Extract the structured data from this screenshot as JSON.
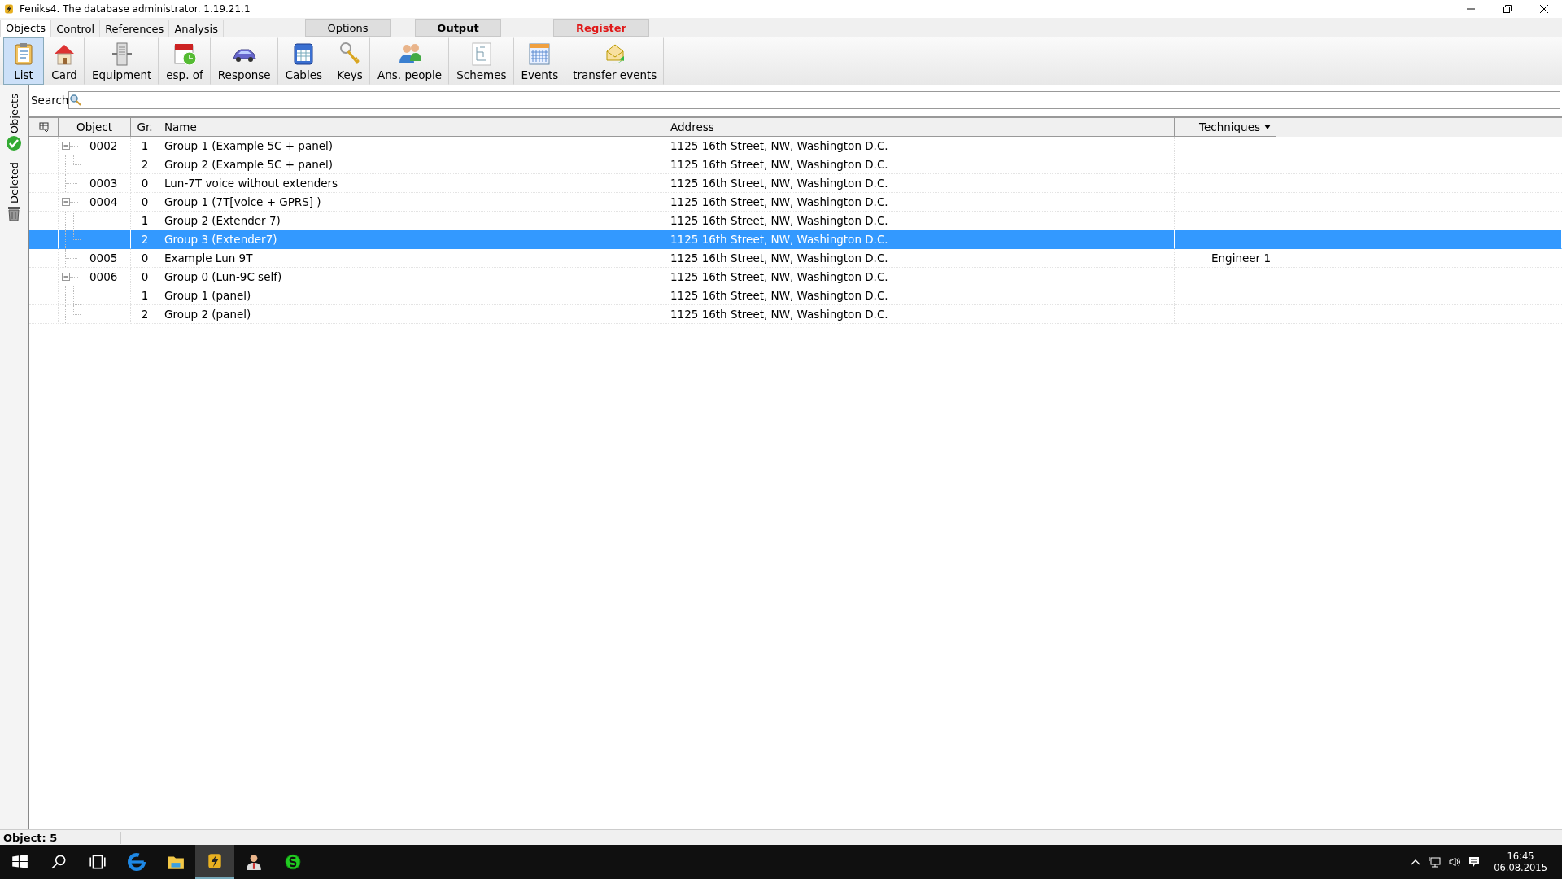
{
  "window": {
    "title": "Feniks4. The database administrator. 1.19.21.1"
  },
  "menu_tabs": [
    {
      "label": "Objects",
      "selected": true
    },
    {
      "label": "Control",
      "selected": false
    },
    {
      "label": "References",
      "selected": false
    },
    {
      "label": "Analysis",
      "selected": false
    }
  ],
  "top_buttons": [
    {
      "label": "Options",
      "kind": "plain"
    },
    {
      "label": "Output",
      "kind": "bold"
    },
    {
      "label": "Register",
      "kind": "alert"
    }
  ],
  "toolbar": [
    {
      "label": "List",
      "kind": "list",
      "selected": true
    },
    {
      "label": "Card",
      "kind": "card",
      "selected": false
    },
    {
      "label": "Equipment",
      "kind": "equipment",
      "selected": false
    },
    {
      "label": "esp. of",
      "kind": "calendar",
      "selected": false
    },
    {
      "label": "Response",
      "kind": "car",
      "selected": false
    },
    {
      "label": "Cables",
      "kind": "cables",
      "selected": false
    },
    {
      "label": "Keys",
      "kind": "keys",
      "selected": false
    },
    {
      "label": "Ans. people",
      "kind": "people",
      "selected": false
    },
    {
      "label": "Schemes",
      "kind": "schemes",
      "selected": false
    },
    {
      "label": "Events",
      "kind": "events",
      "selected": false
    },
    {
      "label": "transfer events",
      "kind": "transfer",
      "selected": false
    }
  ],
  "side_tabs": [
    {
      "label": "Objects",
      "kind": "check"
    },
    {
      "label": "Deleted",
      "kind": "trash"
    }
  ],
  "search": {
    "label": "Search"
  },
  "table": {
    "columns": [
      "Object",
      "Gr.",
      "Name",
      "Address",
      "Techniques"
    ],
    "rows": [
      {
        "object": "0002",
        "group": "1",
        "name": "Group 1 (Example 5C + panel)",
        "address": "1125 16th Street, NW, Washington D.C.",
        "selected": false,
        "expanded": true,
        "children": [
          {
            "group": "2",
            "name": "Group 2 (Example 5C + panel)",
            "address": "1125 16th Street, NW, Washington D.C.",
            "selected": false
          }
        ]
      },
      {
        "object": "0003",
        "group": "0",
        "name": "Lun-7T voice without extenders",
        "address": "1125 16th Street, NW, Washington D.C.",
        "selected": false
      },
      {
        "object": "0004",
        "group": "0",
        "name": "Group 1 (7T[voice + GPRS] )",
        "address": "1125 16th Street, NW, Washington D.C.",
        "selected": false,
        "expanded": true,
        "children": [
          {
            "group": "1",
            "name": "Group 2 (Extender 7)",
            "address": "1125 16th Street, NW, Washington D.C.",
            "selected": false
          },
          {
            "group": "2",
            "name": "Group 3 (Extender7)",
            "address": "1125 16th Street, NW, Washington D.C.",
            "selected": true
          }
        ]
      },
      {
        "object": "0005",
        "group": "0",
        "name": "Example Lun 9T",
        "address": "1125 16th Street, NW, Washington D.C.",
        "techniques": "Engineer 1",
        "selected": false
      },
      {
        "object": "0006",
        "group": "0",
        "name": "Group 0 (Lun-9C self)",
        "address": "1125 16th Street, NW, Washington D.C.",
        "selected": false,
        "expanded": true,
        "children": [
          {
            "group": "1",
            "name": "Group 1 (panel)",
            "address": "1125 16th Street, NW, Washington D.C.",
            "selected": false
          },
          {
            "group": "2",
            "name": "Group 2 (panel)",
            "address": "1125 16th Street, NW, Washington D.C.",
            "selected": false
          }
        ]
      }
    ]
  },
  "status_bar": {
    "text": "Object: 5"
  },
  "taskbar": {
    "apps": [
      {
        "kind": "start",
        "selected": false
      },
      {
        "kind": "search",
        "selected": false
      },
      {
        "kind": "taskview",
        "selected": false
      },
      {
        "kind": "browser",
        "selected": false
      },
      {
        "kind": "folder",
        "selected": false
      },
      {
        "kind": "bolt",
        "selected": true
      },
      {
        "kind": "person",
        "selected": false
      },
      {
        "kind": "coin",
        "selected": false
      }
    ],
    "time": "16:45",
    "date": "06.08.2015"
  }
}
